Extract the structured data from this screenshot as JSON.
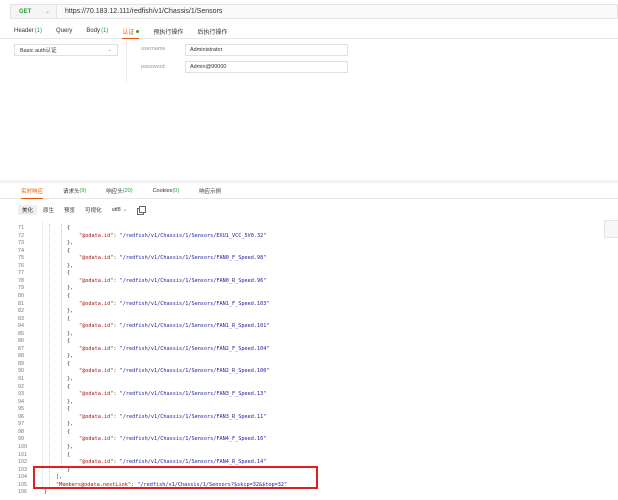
{
  "request": {
    "method": "GET",
    "url": "https://70.183.12.111/redfish/v1/Chassis/1/Sensors"
  },
  "request_tabs": [
    {
      "label": "Header",
      "count": "(1)",
      "active": false
    },
    {
      "label": "Query",
      "count": "",
      "active": false
    },
    {
      "label": "Body",
      "count": "(1)",
      "active": false
    },
    {
      "label": "认证",
      "count": "",
      "active": true,
      "dot": true
    },
    {
      "label": "预执行操作",
      "count": "",
      "active": false
    },
    {
      "label": "后执行操作",
      "count": "",
      "active": false
    }
  ],
  "auth": {
    "type": "Basic auth认证",
    "username_label": "username",
    "username_value": "Administrator",
    "password_label": "password",
    "password_value": "Admin@90000"
  },
  "response_tabs": [
    {
      "label": "实时响应",
      "count": "",
      "active": true
    },
    {
      "label": "请求头",
      "count": "(9)",
      "active": false
    },
    {
      "label": "响应头",
      "count": "(20)",
      "active": false
    },
    {
      "label": "Cookies",
      "count": "(0)",
      "active": false
    },
    {
      "label": "响应示例",
      "count": "",
      "active": false
    }
  ],
  "view_modes": [
    {
      "label": "美化",
      "active": true
    },
    {
      "label": "原生",
      "active": false
    },
    {
      "label": "预览",
      "active": false
    },
    {
      "label": "可视化",
      "active": false
    }
  ],
  "encoding": "utf8",
  "code_lines": [
    {
      "n": "71",
      "indent": 1,
      "parts": [
        {
          "t": "{",
          "c": "p"
        }
      ]
    },
    {
      "n": "72",
      "indent": 2,
      "parts": [
        {
          "t": "\"@odata.id\"",
          "c": "k"
        },
        {
          "t": ": ",
          "c": "p"
        },
        {
          "t": "\"/redfish/v1/Chassis/1/Sensors/EXU1_VCC_5V0.32\"",
          "c": "s"
        }
      ]
    },
    {
      "n": "73",
      "indent": 1,
      "parts": [
        {
          "t": "},",
          "c": "p"
        }
      ]
    },
    {
      "n": "74",
      "indent": 1,
      "parts": [
        {
          "t": "{",
          "c": "p"
        }
      ]
    },
    {
      "n": "75",
      "indent": 2,
      "parts": [
        {
          "t": "\"@odata.id\"",
          "c": "k"
        },
        {
          "t": ": ",
          "c": "p"
        },
        {
          "t": "\"/redfish/v1/Chassis/1/Sensors/FAN0_F_Speed.98\"",
          "c": "s"
        }
      ]
    },
    {
      "n": "76",
      "indent": 1,
      "parts": [
        {
          "t": "},",
          "c": "p"
        }
      ]
    },
    {
      "n": "77",
      "indent": 1,
      "parts": [
        {
          "t": "{",
          "c": "p"
        }
      ]
    },
    {
      "n": "78",
      "indent": 2,
      "parts": [
        {
          "t": "\"@odata.id\"",
          "c": "k"
        },
        {
          "t": ": ",
          "c": "p"
        },
        {
          "t": "\"/redfish/v1/Chassis/1/Sensors/FAN0_R_Speed.96\"",
          "c": "s"
        }
      ]
    },
    {
      "n": "79",
      "indent": 1,
      "parts": [
        {
          "t": "},",
          "c": "p"
        }
      ]
    },
    {
      "n": "80",
      "indent": 1,
      "parts": [
        {
          "t": "{",
          "c": "p"
        }
      ]
    },
    {
      "n": "81",
      "indent": 2,
      "parts": [
        {
          "t": "\"@odata.id\"",
          "c": "k"
        },
        {
          "t": ": ",
          "c": "p"
        },
        {
          "t": "\"/redfish/v1/Chassis/1/Sensors/FAN1_F_Speed.103\"",
          "c": "s"
        }
      ]
    },
    {
      "n": "82",
      "indent": 1,
      "parts": [
        {
          "t": "},",
          "c": "p"
        }
      ]
    },
    {
      "n": "83",
      "indent": 1,
      "parts": [
        {
          "t": "{",
          "c": "p"
        }
      ]
    },
    {
      "n": "84",
      "indent": 2,
      "parts": [
        {
          "t": "\"@odata.id\"",
          "c": "k"
        },
        {
          "t": ": ",
          "c": "p"
        },
        {
          "t": "\"/redfish/v1/Chassis/1/Sensors/FAN1_R_Speed.101\"",
          "c": "s"
        }
      ]
    },
    {
      "n": "85",
      "indent": 1,
      "parts": [
        {
          "t": "},",
          "c": "p"
        }
      ]
    },
    {
      "n": "86",
      "indent": 1,
      "parts": [
        {
          "t": "{",
          "c": "p"
        }
      ]
    },
    {
      "n": "87",
      "indent": 2,
      "parts": [
        {
          "t": "\"@odata.id\"",
          "c": "k"
        },
        {
          "t": ": ",
          "c": "p"
        },
        {
          "t": "\"/redfish/v1/Chassis/1/Sensors/FAN2_F_Speed.104\"",
          "c": "s"
        }
      ]
    },
    {
      "n": "88",
      "indent": 1,
      "parts": [
        {
          "t": "},",
          "c": "p"
        }
      ]
    },
    {
      "n": "89",
      "indent": 1,
      "parts": [
        {
          "t": "{",
          "c": "p"
        }
      ]
    },
    {
      "n": "90",
      "indent": 2,
      "parts": [
        {
          "t": "\"@odata.id\"",
          "c": "k"
        },
        {
          "t": ": ",
          "c": "p"
        },
        {
          "t": "\"/redfish/v1/Chassis/1/Sensors/FAN2_R_Speed.100\"",
          "c": "s"
        }
      ]
    },
    {
      "n": "91",
      "indent": 1,
      "parts": [
        {
          "t": "},",
          "c": "p"
        }
      ]
    },
    {
      "n": "92",
      "indent": 1,
      "parts": [
        {
          "t": "{",
          "c": "p"
        }
      ]
    },
    {
      "n": "93",
      "indent": 2,
      "parts": [
        {
          "t": "\"@odata.id\"",
          "c": "k"
        },
        {
          "t": ": ",
          "c": "p"
        },
        {
          "t": "\"/redfish/v1/Chassis/1/Sensors/FAN3_F_Speed.13\"",
          "c": "s"
        }
      ]
    },
    {
      "n": "94",
      "indent": 1,
      "parts": [
        {
          "t": "},",
          "c": "p"
        }
      ]
    },
    {
      "n": "95",
      "indent": 1,
      "parts": [
        {
          "t": "{",
          "c": "p"
        }
      ]
    },
    {
      "n": "96",
      "indent": 2,
      "parts": [
        {
          "t": "\"@odata.id\"",
          "c": "k"
        },
        {
          "t": ": ",
          "c": "p"
        },
        {
          "t": "\"/redfish/v1/Chassis/1/Sensors/FAN3_R_Speed.11\"",
          "c": "s"
        }
      ]
    },
    {
      "n": "97",
      "indent": 1,
      "parts": [
        {
          "t": "},",
          "c": "p"
        }
      ]
    },
    {
      "n": "98",
      "indent": 1,
      "parts": [
        {
          "t": "{",
          "c": "p"
        }
      ]
    },
    {
      "n": "99",
      "indent": 2,
      "parts": [
        {
          "t": "\"@odata.id\"",
          "c": "k"
        },
        {
          "t": ": ",
          "c": "p"
        },
        {
          "t": "\"/redfish/v1/Chassis/1/Sensors/FAN4_F_Speed.16\"",
          "c": "s"
        }
      ]
    },
    {
      "n": "100",
      "indent": 1,
      "parts": [
        {
          "t": "},",
          "c": "p"
        }
      ]
    },
    {
      "n": "101",
      "indent": 1,
      "parts": [
        {
          "t": "{",
          "c": "p"
        }
      ]
    },
    {
      "n": "102",
      "indent": 2,
      "parts": [
        {
          "t": "\"@odata.id\"",
          "c": "k"
        },
        {
          "t": ": ",
          "c": "p"
        },
        {
          "t": "\"/redfish/v1/Chassis/1/Sensors/FAN4_R_Speed.14\"",
          "c": "s"
        }
      ]
    },
    {
      "n": "103",
      "indent": 1,
      "parts": [
        {
          "t": "}",
          "c": "p"
        }
      ]
    },
    {
      "n": "104",
      "indent": 0,
      "parts": [
        {
          "t": "],",
          "c": "p"
        }
      ]
    },
    {
      "n": "105",
      "indent": 0,
      "parts": [
        {
          "t": "\"Members@odata.nextLink\"",
          "c": "k"
        },
        {
          "t": ": ",
          "c": "p"
        },
        {
          "t": "\"/redfish/v1/Chassis/1/Sensors?$skip=32&$top=32\"",
          "c": "s"
        }
      ]
    },
    {
      "n": "106",
      "indent": -1,
      "parts": [
        {
          "t": "}",
          "c": "p"
        }
      ]
    }
  ],
  "colors": {
    "accent": "#e8590c",
    "method_get": "#2a9d3a",
    "json_key": "#a31515",
    "json_string": "#2020a0",
    "highlight_border": "#e02020"
  },
  "icons": [
    "chevron-down-icon",
    "copy-icon",
    "status-dot-icon"
  ]
}
